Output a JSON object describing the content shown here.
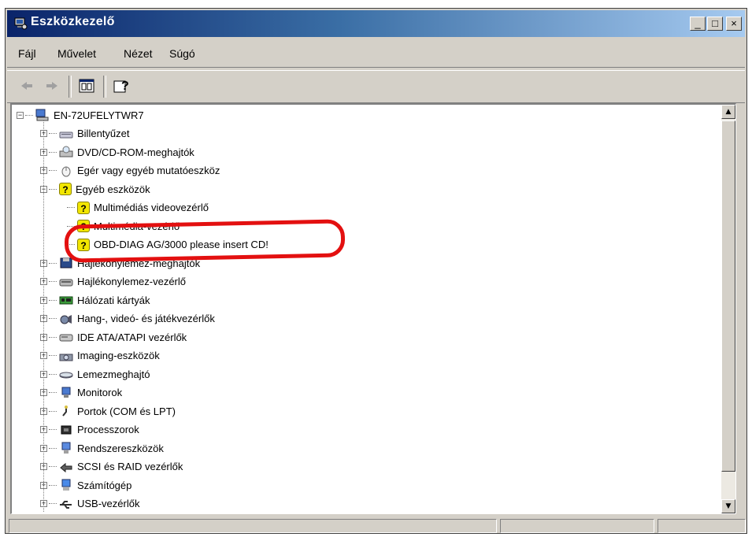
{
  "window": {
    "title": "Eszközkezelő",
    "minimize_glyph": "_",
    "maximize_glyph": "□",
    "close_glyph": "×"
  },
  "menu": [
    "Fájl",
    "Művelet",
    "Nézet",
    "Súgó"
  ],
  "toolbar": {
    "buttons": [
      "back-arrow-icon",
      "forward-arrow-icon",
      "properties-icon",
      "help-icon"
    ]
  },
  "tree": {
    "root": "EN-72UFELYTWR7",
    "items": [
      {
        "label": "Billentyűzet",
        "icon": "keyboard-icon"
      },
      {
        "label": "DVD/CD-ROM-meghajtók",
        "icon": "cdrom-icon"
      },
      {
        "label": "Egér vagy egyéb mutatóeszköz",
        "icon": "mouse-icon"
      },
      {
        "label": "Egyéb eszközök",
        "icon": "warning-icon",
        "expanded": true,
        "children": [
          {
            "label": "Multimédiás videovezérlő",
            "icon": "warning-icon"
          },
          {
            "label": "Multimédia-vezérlő",
            "icon": "warning-icon"
          },
          {
            "label": "OBD-DIAG AG/3000 please insert CD!",
            "icon": "warning-icon"
          }
        ]
      },
      {
        "label": "Hajlékonylemez-meghajtók",
        "icon": "floppy-icon"
      },
      {
        "label": "Hajlékonylemez-vezérlő",
        "icon": "controller-icon"
      },
      {
        "label": "Hálózati kártyák",
        "icon": "network-card-icon"
      },
      {
        "label": "Hang-, videó- és játékvezérlők",
        "icon": "sound-icon"
      },
      {
        "label": "IDE ATA/ATAPI vezérlők",
        "icon": "ide-icon"
      },
      {
        "label": "Imaging-eszközök",
        "icon": "camera-icon"
      },
      {
        "label": "Lemezmeghajtó",
        "icon": "disk-icon"
      },
      {
        "label": "Monitorok",
        "icon": "monitor-icon"
      },
      {
        "label": "Portok (COM és LPT)",
        "icon": "port-icon"
      },
      {
        "label": "Processzorok",
        "icon": "cpu-icon"
      },
      {
        "label": "Rendszereszközök",
        "icon": "system-icon"
      },
      {
        "label": "SCSI és RAID vezérlők",
        "icon": "scsi-icon"
      },
      {
        "label": "Számítógép",
        "icon": "computer-icon"
      },
      {
        "label": "USB-vezérlők",
        "icon": "usb-icon"
      }
    ]
  },
  "colors": {
    "title_gradient_start": "#0a246a",
    "title_gradient_end": "#a6caf0",
    "annotation_red": "#e31010",
    "warning_yellow": "#f2e600"
  }
}
